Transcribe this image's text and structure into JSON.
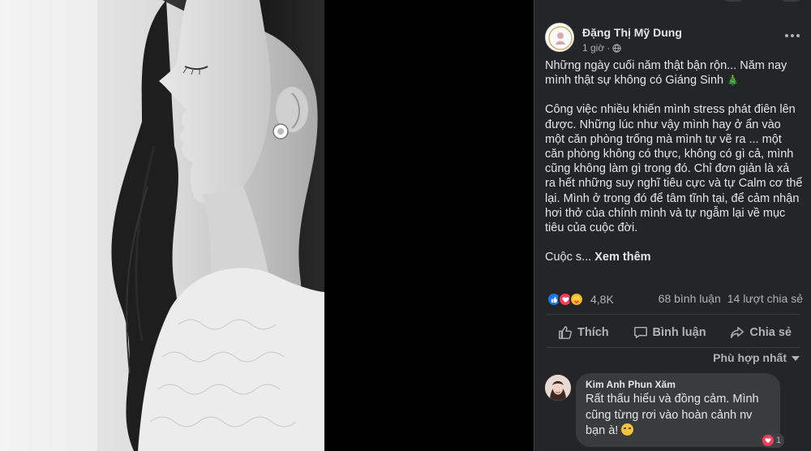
{
  "post": {
    "author": "Đặng Thị Mỹ Dung",
    "time": "1 giờ",
    "separator": "·",
    "privacy_icon": "globe-icon",
    "paragraphs": [
      "Những ngày cuối năm thật bận rộn... Năm nay mình thật sự không có Giáng Sinh",
      "Công việc nhiều khiến mình stress phát điên lên được. Những lúc như vậy mình hay ở ẩn vào một căn phòng trống mà mình tự vẽ ra ... một căn phòng không có thực, không có gì cả, mình cũng không làm gì trong đó. Chỉ đơn giản là xả ra hết những suy nghĩ tiêu cực và tự Calm cơ thể lại. Mình ở trong đó để tâm tĩnh tại, để cảm nhận hơi thở của chính mình và tự ngẫm lại về mục tiêu của cuộc đời."
    ],
    "christmas_tree": "🎄",
    "truncated_text": "Cuộc s...",
    "see_more": "Xem thêm"
  },
  "stats": {
    "reactions": "4,8K",
    "reaction_icons": [
      "like-icon",
      "love-icon",
      "care-icon"
    ],
    "comments": "68 bình luận",
    "shares": "14 lượt chia sẻ"
  },
  "actions": {
    "like": "Thích",
    "comment": "Bình luận",
    "share": "Chia sẻ"
  },
  "sort_label": "Phù hợp nhất",
  "comments": [
    {
      "name": "Kim Anh Phun Xăm",
      "text": "Rất thấu hiểu và đồng cảm. Mình cũng từng rơi vào hoàn cảnh nv bạn à!",
      "reaction_count": "1"
    }
  ],
  "colors": {
    "panel_bg": "#242526",
    "text": "#e4e6eb",
    "secondary": "#b0b3b8",
    "bubble": "#3a3b3c",
    "like_blue": "#1877f2",
    "love_red": "#f33e58"
  }
}
